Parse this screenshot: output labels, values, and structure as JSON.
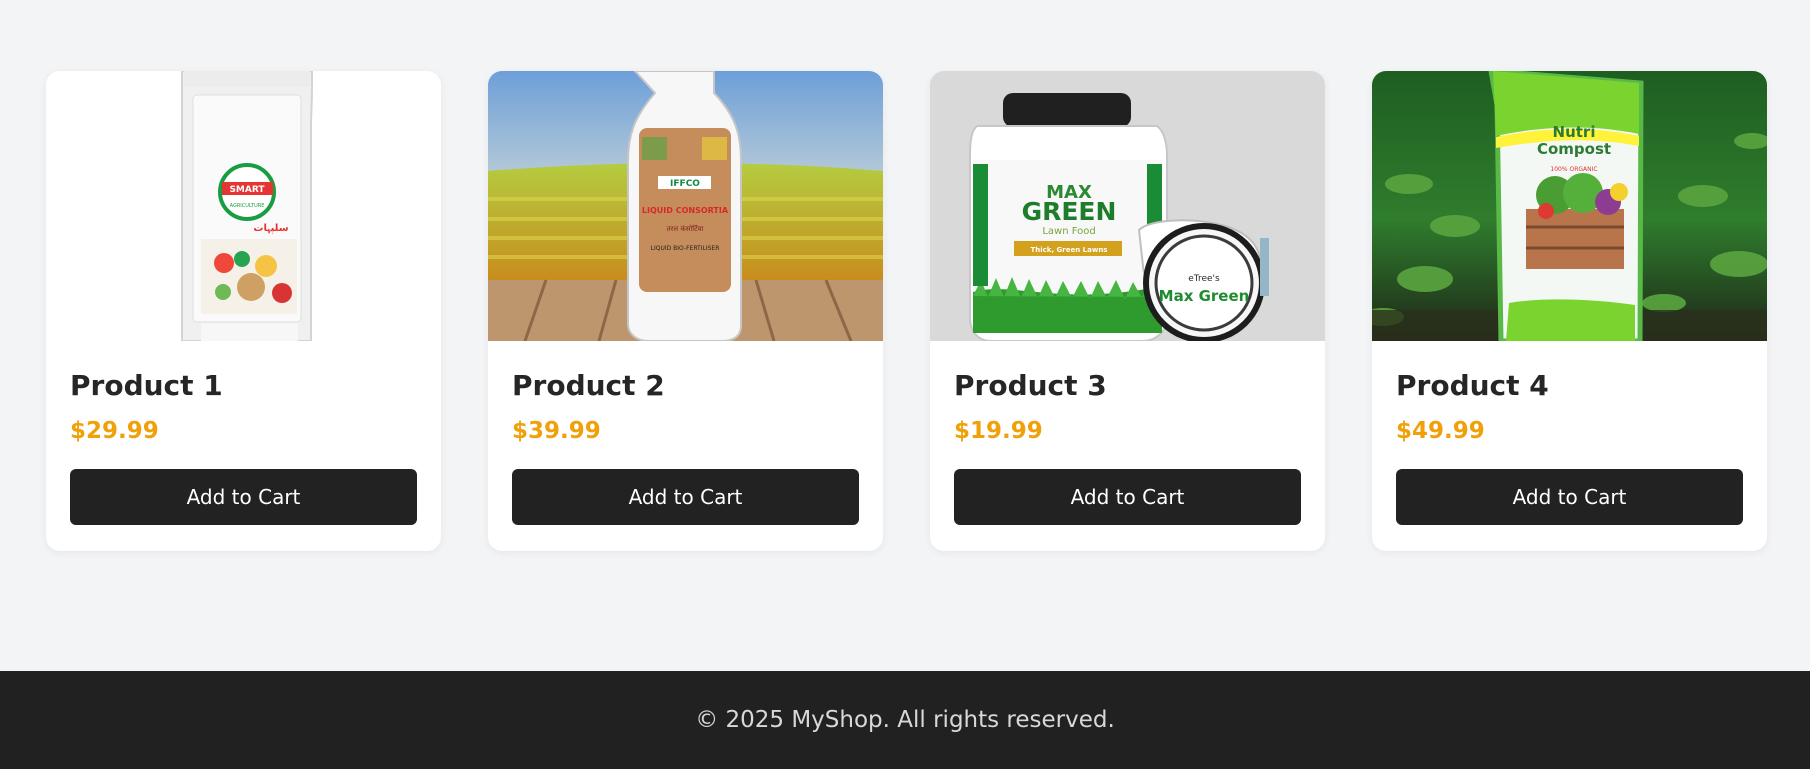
{
  "products": [
    {
      "name": "Product 1",
      "price": "$29.99",
      "button_label": "Add to Cart",
      "image": "smart-agriculture-bottle"
    },
    {
      "name": "Product 2",
      "price": "$39.99",
      "button_label": "Add to Cart",
      "image": "iffco-liquid-consortia-bottle-field"
    },
    {
      "name": "Product 3",
      "price": "$19.99",
      "button_label": "Add to Cart",
      "image": "max-green-lawn-food-container"
    },
    {
      "name": "Product 4",
      "price": "$49.99",
      "button_label": "Add to Cart",
      "image": "nutri-compost-bag-seedlings"
    }
  ],
  "footer": {
    "text": "© 2025 MyShop. All rights reserved."
  },
  "colors": {
    "background": "#f3f4f6",
    "card": "#ffffff",
    "price": "#f0a10a",
    "button": "#222222",
    "footer": "#212121"
  }
}
